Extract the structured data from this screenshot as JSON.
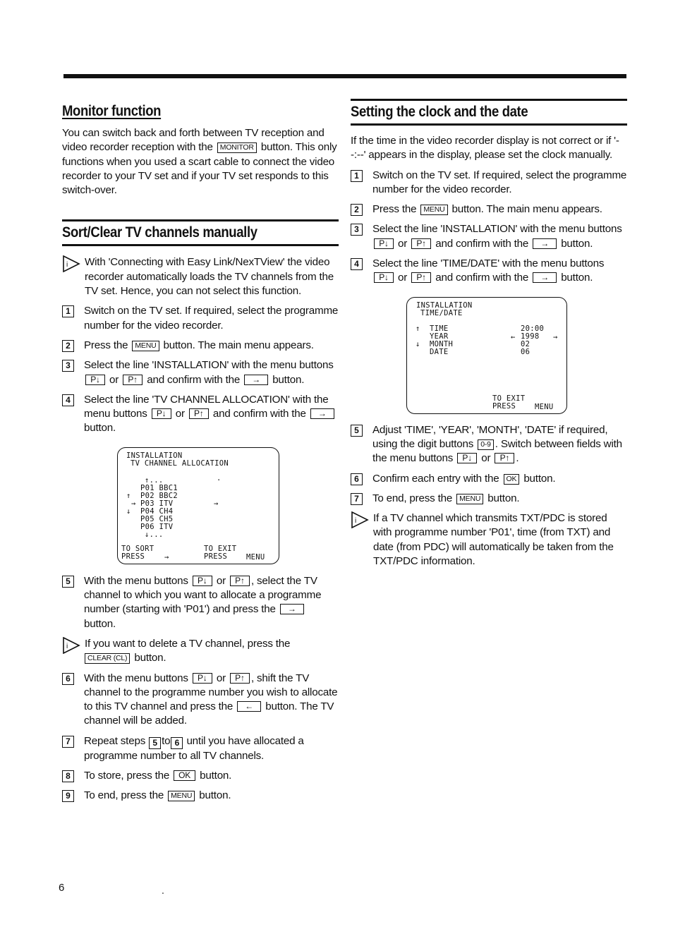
{
  "page": {
    "number": "6",
    "stray_mark": "."
  },
  "monitor": {
    "title": "Monitor function",
    "text_before": "You can switch back and forth between TV reception and video recorder reception with the",
    "key": "MONITOR",
    "text_after": "button. This only functions when you used a scart cable to connect the video recorder to your TV set and if your TV set responds to this switch-over."
  },
  "sort": {
    "title": "Sort/Clear TV channels manually",
    "info1": "With 'Connecting with Easy Link/NexTView' the video recorder automatically loads the TV channels from the TV set. Hence, you can not select this function.",
    "steps": [
      {
        "num": "1",
        "text": "Switch on the TV set. If required, select the programme number for the video recorder."
      },
      {
        "num": "2",
        "a": "Press the",
        "key": "MENU",
        "b": "button. The main menu appears."
      },
      {
        "num": "3",
        "a": "Select the line 'INSTALLATION' with the menu buttons",
        "k1": "P↓",
        "or": "or",
        "k2": "P↑",
        "b": "and confirm with the",
        "k3": "→",
        "c": "button."
      },
      {
        "num": "4",
        "a": "Select the line 'TV CHANNEL ALLOCATION' with the menu buttons",
        "k1": "P↓",
        "or": "or",
        "k2": "P↑",
        "b": "and confirm with the",
        "k3": "→",
        "c": "button."
      },
      {
        "num": "5",
        "a": "With the menu buttons",
        "k1": "P↓",
        "or": "or",
        "k2": "P↑",
        "b": ", select the TV channel to which you want to allocate a programme number (starting with 'P01') and press the",
        "k3": "→",
        "c": "button."
      },
      {
        "num": "6",
        "a": "With the menu buttons",
        "k1": "P↓",
        "or": "or",
        "k2": "P↑",
        "b": ", shift the TV channel to the programme number you wish to allocate to this TV channel and press the",
        "k3": "←",
        "c": "button. The TV channel will be added."
      },
      {
        "num": "7",
        "a": "Repeat steps",
        "r1": "5",
        "to": "to",
        "r2": "6",
        "b": "until you have allocated a programme number to all TV channels."
      },
      {
        "num": "8",
        "a": "To store, press the",
        "key": "OK",
        "b": "button."
      },
      {
        "num": "9",
        "a": "To end, press the",
        "key": "MENU",
        "b": "button."
      }
    ],
    "info2": {
      "a": "If you want to delete a TV channel, press the",
      "key": "CLEAR (CL)",
      "b": "button."
    },
    "screen": {
      "title1": "INSTALLATION",
      "title2": "TV CHANNEL ALLOCATION",
      "more_top": "↑...",
      "rows": [
        {
          "prog": "P01",
          "chan": "BBC1"
        },
        {
          "prog": "P02",
          "chan": "BBC2"
        },
        {
          "prog": "P03",
          "chan": "ITV"
        },
        {
          "prog": "P04",
          "chan": "CH4"
        },
        {
          "prog": "P05",
          "chan": "CH5"
        },
        {
          "prog": "P06",
          "chan": "ITV"
        }
      ],
      "more_bottom": "↓...",
      "up_marker": "↑",
      "down_marker": "↓",
      "cursor_left": "→",
      "cursor_right": "→",
      "dot": "·",
      "sort_label1": "TO SORT",
      "sort_label2": "PRESS",
      "sort_key": "→",
      "exit_label1": "TO EXIT",
      "exit_label2": "PRESS",
      "exit_key": "MENU"
    }
  },
  "clock": {
    "title": "Setting the clock and the date",
    "intro": "If the time in the video recorder display is not correct or if '--:--' appears in the display, please set the clock manually.",
    "steps": [
      {
        "num": "1",
        "text": "Switch on the TV set. If required, select the programme number for the video recorder."
      },
      {
        "num": "2",
        "a": "Press the",
        "key": "MENU",
        "b": "button. The main menu appears."
      },
      {
        "num": "3",
        "a": "Select the line 'INSTALLATION' with the menu buttons",
        "k1": "P↓",
        "or": "or",
        "k2": "P↑",
        "b": "and confirm with the",
        "k3": "→",
        "c": "button."
      },
      {
        "num": "4",
        "a": "Select the line 'TIME/DATE' with the menu buttons",
        "k1": "P↓",
        "or": "or",
        "k2": "P↑",
        "b": "and confirm with the",
        "k3": "→",
        "c": "button."
      },
      {
        "num": "5",
        "a": "Adjust 'TIME', 'YEAR', 'MONTH', 'DATE' if required, using the digit buttons",
        "k0": "0-9",
        "b": ". Switch between fields with the menu buttons",
        "k1": "P↓",
        "or": "or",
        "k2": "P↑",
        "c": "."
      },
      {
        "num": "6",
        "a": "Confirm each entry with the",
        "key": "OK",
        "b": "button."
      },
      {
        "num": "7",
        "a": "To end, press the",
        "key": "MENU",
        "b": "button."
      }
    ],
    "info": "If a TV channel which transmits TXT/PDC is stored with programme number 'P01', time (from TXT) and date (from PDC) will automatically be taken from the TXT/PDC information.",
    "screen": {
      "title1": "INSTALLATION",
      "title2": "TIME/DATE",
      "fields": [
        {
          "label": "TIME",
          "value": "20:00"
        },
        {
          "label": "YEAR",
          "value": "1998"
        },
        {
          "label": "MONTH",
          "value": "02"
        },
        {
          "label": "DATE",
          "value": "06"
        }
      ],
      "up_marker": "↑",
      "down_marker": "↓",
      "left_marker": "←",
      "right_marker": "→",
      "exit_label1": "TO EXIT",
      "exit_label2": "PRESS",
      "exit_key": "MENU"
    }
  }
}
